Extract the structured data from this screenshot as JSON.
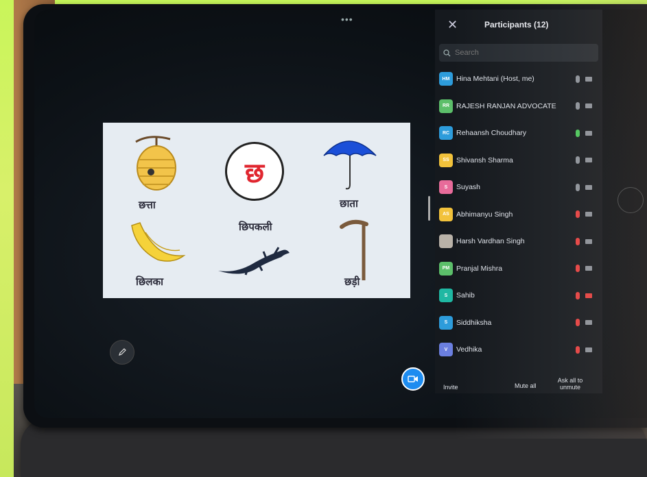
{
  "meeting": {
    "more_dots": "•••"
  },
  "slide": {
    "center_letter": "छ",
    "words": {
      "beehive": "छत्ता",
      "umbrella": "छाता",
      "lizard": "छिपकली",
      "peel": "छिलका",
      "stick": "छड़ी"
    }
  },
  "panel": {
    "title": "Participants (12)",
    "search_placeholder": "Search",
    "participants": [
      {
        "initials": "HM",
        "name": "Hina Mehtani (Host, me)",
        "avatar_color": "#2d9cdb",
        "mic": "#8d939b",
        "cam": "#8d939b"
      },
      {
        "initials": "RR",
        "name": "RAJESH RANJAN ADVOCATE",
        "avatar_color": "#5cbf6a",
        "mic": "#8d939b",
        "cam": "#8d939b"
      },
      {
        "initials": "RC",
        "name": "Rehaansh Choudhary",
        "avatar_color": "#2d9cdb",
        "mic": "#4ac95a",
        "cam": "#8d939b"
      },
      {
        "initials": "SS",
        "name": "Shivansh Sharma",
        "avatar_color": "#f2c23b",
        "mic": "#8d939b",
        "cam": "#8d939b"
      },
      {
        "initials": "S",
        "name": "Suyash",
        "avatar_color": "#e86b9a",
        "mic": "#8d939b",
        "cam": "#8d939b"
      },
      {
        "initials": "AS",
        "name": "Abhimanyu Singh",
        "avatar_color": "#f2c23b",
        "mic": "#e84040",
        "cam": "#8d939b"
      },
      {
        "initials": "",
        "name": "Harsh Vardhan Singh",
        "avatar_color": "#b9b2a8",
        "mic": "#e84040",
        "cam": "#8d939b"
      },
      {
        "initials": "PM",
        "name": "Pranjal Mishra",
        "avatar_color": "#5cbf6a",
        "mic": "#e84040",
        "cam": "#8d939b"
      },
      {
        "initials": "S",
        "name": "Sahib",
        "avatar_color": "#1fb8a3",
        "mic": "#e84040",
        "cam": "#e84040"
      },
      {
        "initials": "S",
        "name": "Siddhiksha",
        "avatar_color": "#2d9cdb",
        "mic": "#e84040",
        "cam": "#8d939b"
      },
      {
        "initials": "V",
        "name": "Vedhika",
        "avatar_color": "#6b7fe0",
        "mic": "#e84040",
        "cam": "#8d939b"
      }
    ],
    "footer": {
      "invite": "Invite",
      "mute_all": "Mute all",
      "ask_unmute": "Ask all to unmute"
    }
  }
}
